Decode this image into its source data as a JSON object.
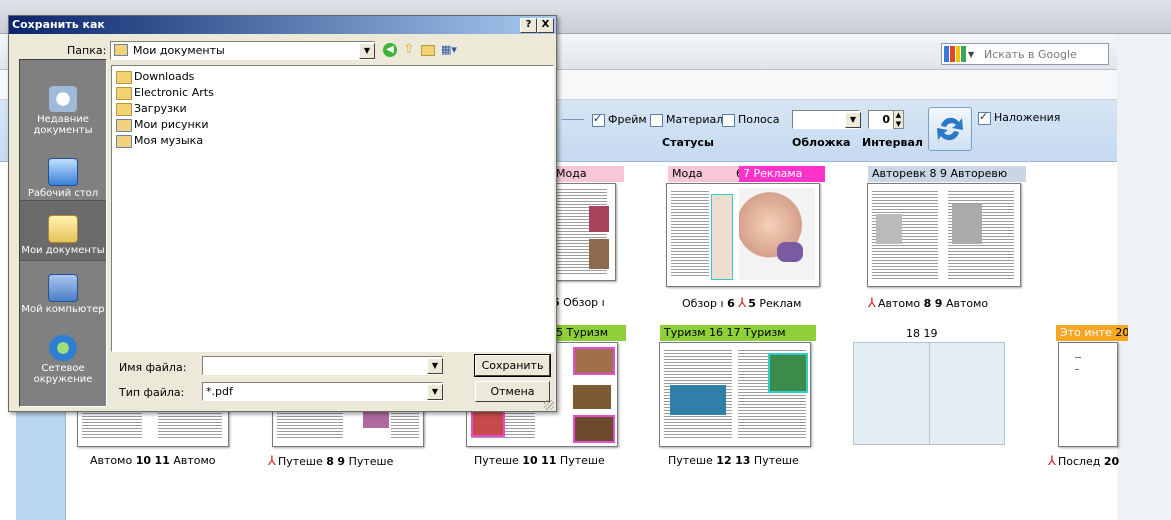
{
  "browser": {
    "search_placeholder": "Искать в Google"
  },
  "toolbar": {
    "frame_label": "Фрейм",
    "material_label": "Материал",
    "stripe_label": "Полоса",
    "overlays_label": "Наложения",
    "interval_value": "0",
    "statuses_label": "Статусы",
    "cover_label": "Обложка",
    "interval_label": "Интервал"
  },
  "spreads_row1": [
    {
      "top_left": "Мода",
      "top_left_color": "#f7c6d9",
      "caption_num": "5",
      "caption_text": "Обзор"
    },
    {
      "top_left": "Мода",
      "num_left": "6",
      "num_right": "7",
      "top_right": "Реклама",
      "top_left_color": "#f7c6d9",
      "top_right_color": "#ff33cc",
      "caption_left": "Обзор",
      "caption_num_l": "6",
      "caption_num_r": "5",
      "caption_right": "Реклам"
    },
    {
      "top_left": "Авторевк",
      "num_left": "8",
      "num_right": "9",
      "top_right": "Авторевю",
      "top_color": "#c9d6e6",
      "caption_left": "Автомо",
      "caption_num_l": "8",
      "caption_num_r": "9",
      "caption_right": "Автомо"
    }
  ],
  "spreads_row2": [
    {
      "caption_left": "Автомо",
      "num_l": "10",
      "num_r": "11",
      "caption_right": "Автомо"
    },
    {
      "caption_left": "Путеше",
      "num_l": "8",
      "num_r": "9",
      "caption_right": "Путеше"
    },
    {
      "top_right": "Туризм",
      "num_right": "5",
      "caption_left": "Путеше",
      "num_l": "10",
      "num_r": "11",
      "caption_right": "Путеше"
    },
    {
      "top_left": "Туризм",
      "num_left": "16",
      "num_right": "17",
      "top_right": "Туризм",
      "tag_color": "#8ecf3a",
      "caption_left": "Путеше",
      "num_l": "12",
      "num_r": "13",
      "caption_right": "Путеше"
    },
    {
      "num_left": "18",
      "num_right": "19"
    },
    {
      "top_left": "Это инте",
      "num_right": "20",
      "tag_color": "#f5a623",
      "caption_left": "Послед",
      "num_r": "20"
    }
  ],
  "dialog": {
    "title": "Сохранить как",
    "help_btn": "?",
    "close_btn": "X",
    "folder_label": "Папка:",
    "folder_value": "Мои документы",
    "places": [
      {
        "label": "Недавние документы",
        "icon": "recent-docs-icon"
      },
      {
        "label": "Рабочий стол",
        "icon": "desktop-icon"
      },
      {
        "label": "Мои документы",
        "icon": "my-documents-icon"
      },
      {
        "label": "Мой компьютер",
        "icon": "my-computer-icon"
      },
      {
        "label": "Сетевое окружение",
        "icon": "network-icon"
      }
    ],
    "files": [
      "Downloads",
      "Electronic Arts",
      "Загрузки",
      "Мои рисунки",
      "Моя музыка"
    ],
    "filename_label": "Имя файла:",
    "filename_value": "",
    "filetype_label": "Тип файла:",
    "filetype_value": "*.pdf",
    "save_button": "Сохранить",
    "cancel_button": "Отмена"
  }
}
